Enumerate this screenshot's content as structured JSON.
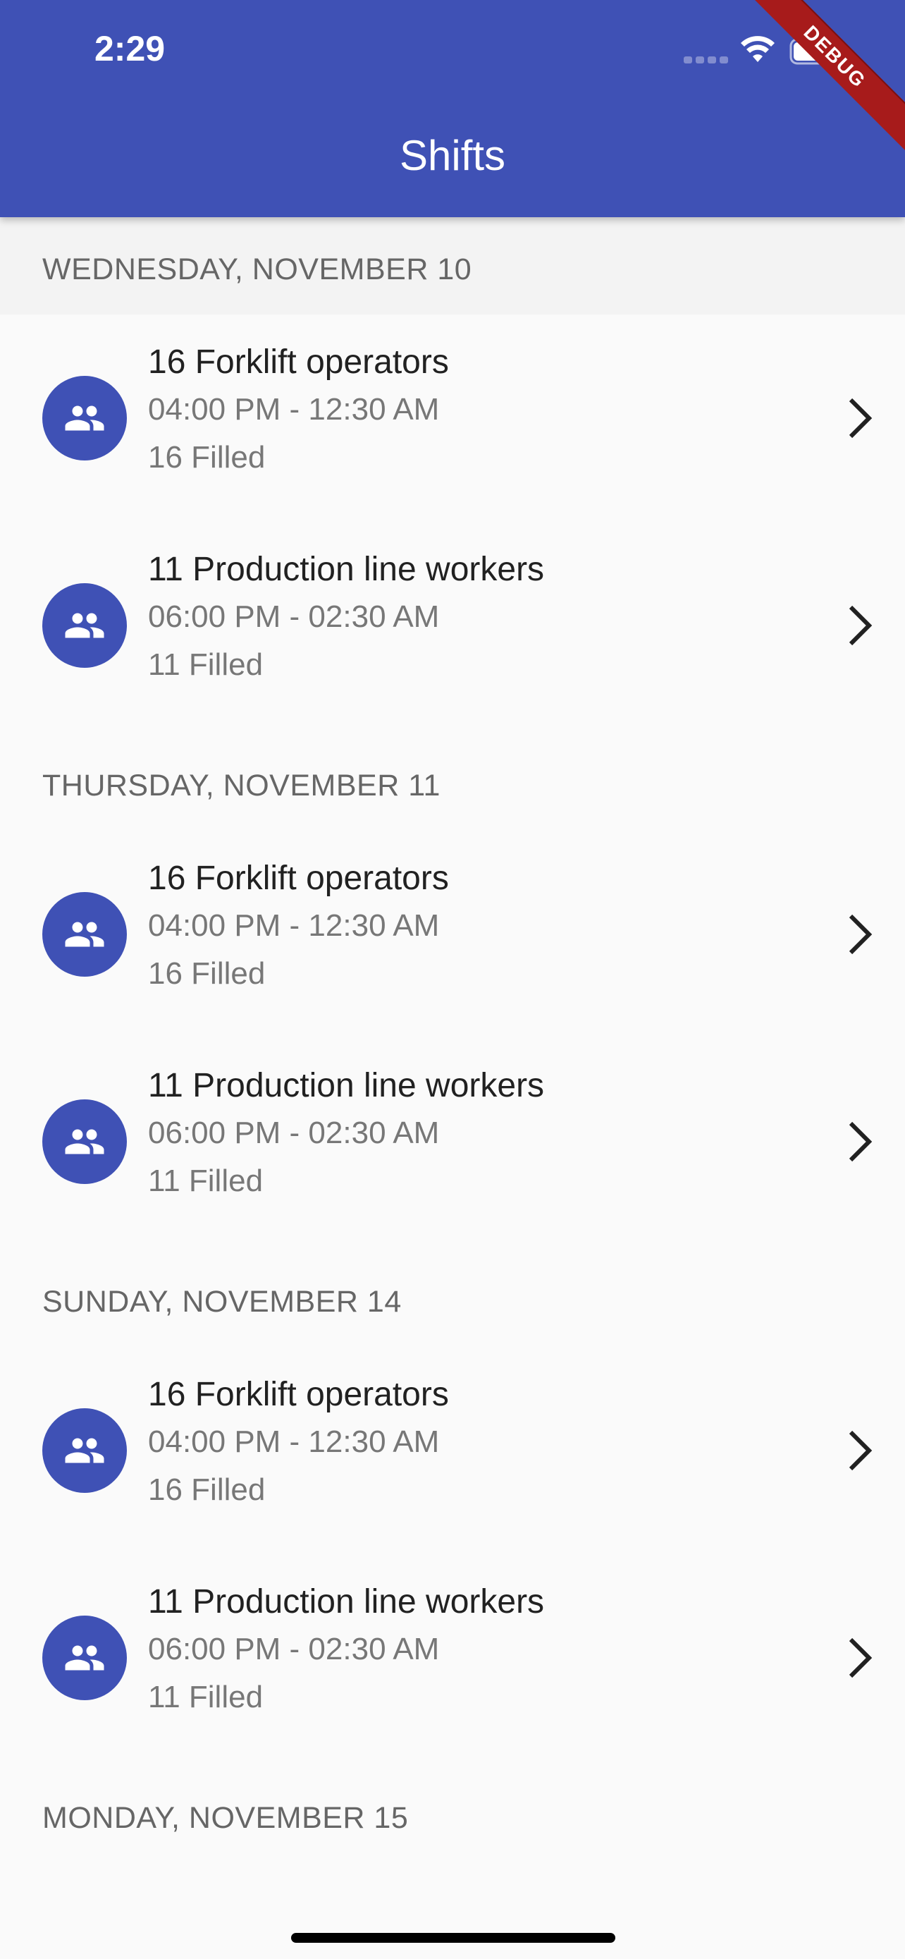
{
  "status_bar": {
    "time": "2:29"
  },
  "app_bar": {
    "title": "Shifts",
    "debug_label": "DEBUG",
    "color": "#3f51b5"
  },
  "icons": {
    "avatar": "group-icon",
    "trailing": "chevron-right-icon"
  },
  "sections": [
    {
      "header": "WEDNESDAY, NOVEMBER 10",
      "items": [
        {
          "title": "16 Forklift operators",
          "time": "04:00 PM - 12:30 AM",
          "filled": "16 Filled"
        },
        {
          "title": "11 Production line workers",
          "time": "06:00 PM - 02:30 AM",
          "filled": "11 Filled"
        }
      ]
    },
    {
      "header": "THURSDAY, NOVEMBER 11",
      "items": [
        {
          "title": "16 Forklift operators",
          "time": "04:00 PM - 12:30 AM",
          "filled": "16 Filled"
        },
        {
          "title": "11 Production line workers",
          "time": "06:00 PM - 02:30 AM",
          "filled": "11 Filled"
        }
      ]
    },
    {
      "header": "SUNDAY, NOVEMBER 14",
      "items": [
        {
          "title": "16 Forklift operators",
          "time": "04:00 PM - 12:30 AM",
          "filled": "16 Filled"
        },
        {
          "title": "11 Production line workers",
          "time": "06:00 PM - 02:30 AM",
          "filled": "11 Filled"
        }
      ]
    },
    {
      "header": "MONDAY, NOVEMBER 15",
      "items": []
    }
  ]
}
